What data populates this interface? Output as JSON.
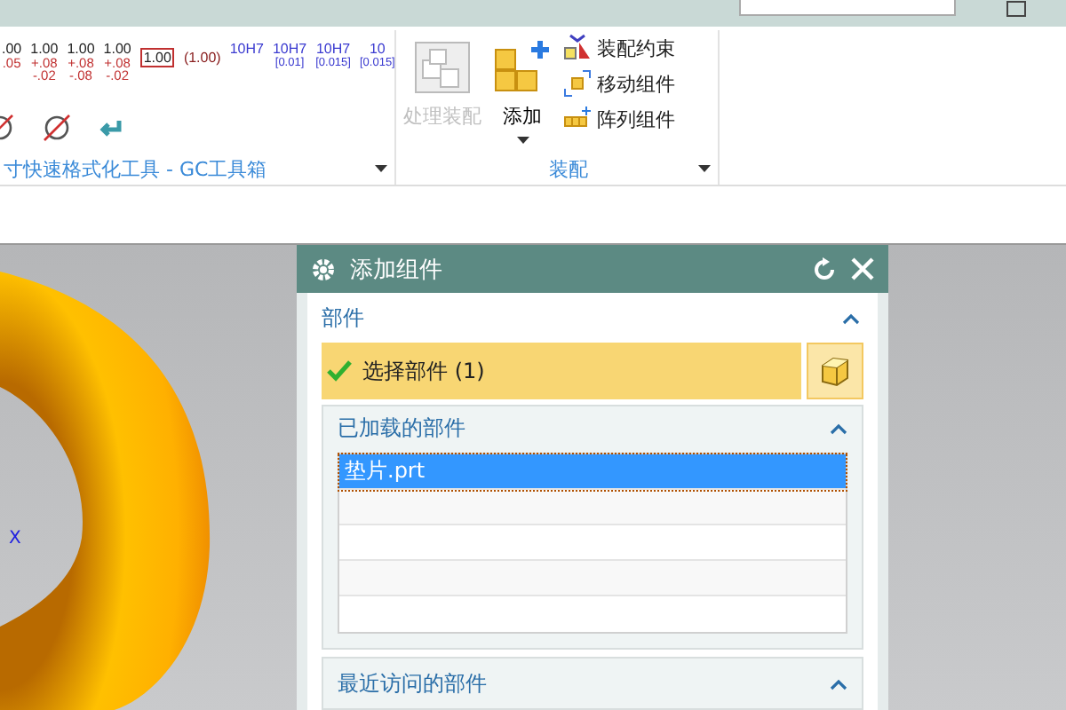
{
  "ribbon": {
    "groups": [
      {
        "label": "寸快速格式化工具 - GC工具箱",
        "tolerance_formats": [
          {
            "kind": "stack",
            "main": ".00",
            "lower": ".05"
          },
          {
            "kind": "stack",
            "main": "1.00",
            "upper": "+.08",
            "lower": "-.02"
          },
          {
            "kind": "stack",
            "main": "1.00",
            "upper": "+.08",
            "lower": "-.08"
          },
          {
            "kind": "stack",
            "main": "1.00",
            "upper": "+.08",
            "lower": "-.02"
          },
          {
            "kind": "boxed",
            "main": "1.00"
          },
          {
            "kind": "plain",
            "main": "(1.00)"
          },
          {
            "kind": "fit",
            "main": "10H7"
          },
          {
            "kind": "fit",
            "main": "10H7",
            "lower": "[0.01]"
          },
          {
            "kind": "fit",
            "main": "10H7",
            "lower": "[0.015]"
          },
          {
            "kind": "fit",
            "main": "10",
            "lower": "[0.015]"
          }
        ]
      },
      {
        "label": "装配",
        "large_buttons": [
          {
            "label": "处理装配",
            "disabled": true,
            "dropdown": false
          },
          {
            "label": "添加",
            "disabled": false,
            "dropdown": true
          }
        ],
        "small_buttons": [
          {
            "label": "装配约束"
          },
          {
            "label": "移动组件"
          },
          {
            "label": "阵列组件"
          }
        ]
      }
    ]
  },
  "viewport": {
    "axis_label": "X"
  },
  "dialog": {
    "title": "添加组件",
    "sections": [
      {
        "title": "部件",
        "expanded": true,
        "selection": {
          "label": "选择部件 (1)",
          "complete": true
        },
        "subsection": {
          "title": "已加载的部件",
          "expanded": true,
          "items": [
            {
              "name": "垫片.prt",
              "selected": true
            }
          ]
        }
      },
      {
        "title": "最近访问的部件",
        "expanded": true
      }
    ]
  }
}
